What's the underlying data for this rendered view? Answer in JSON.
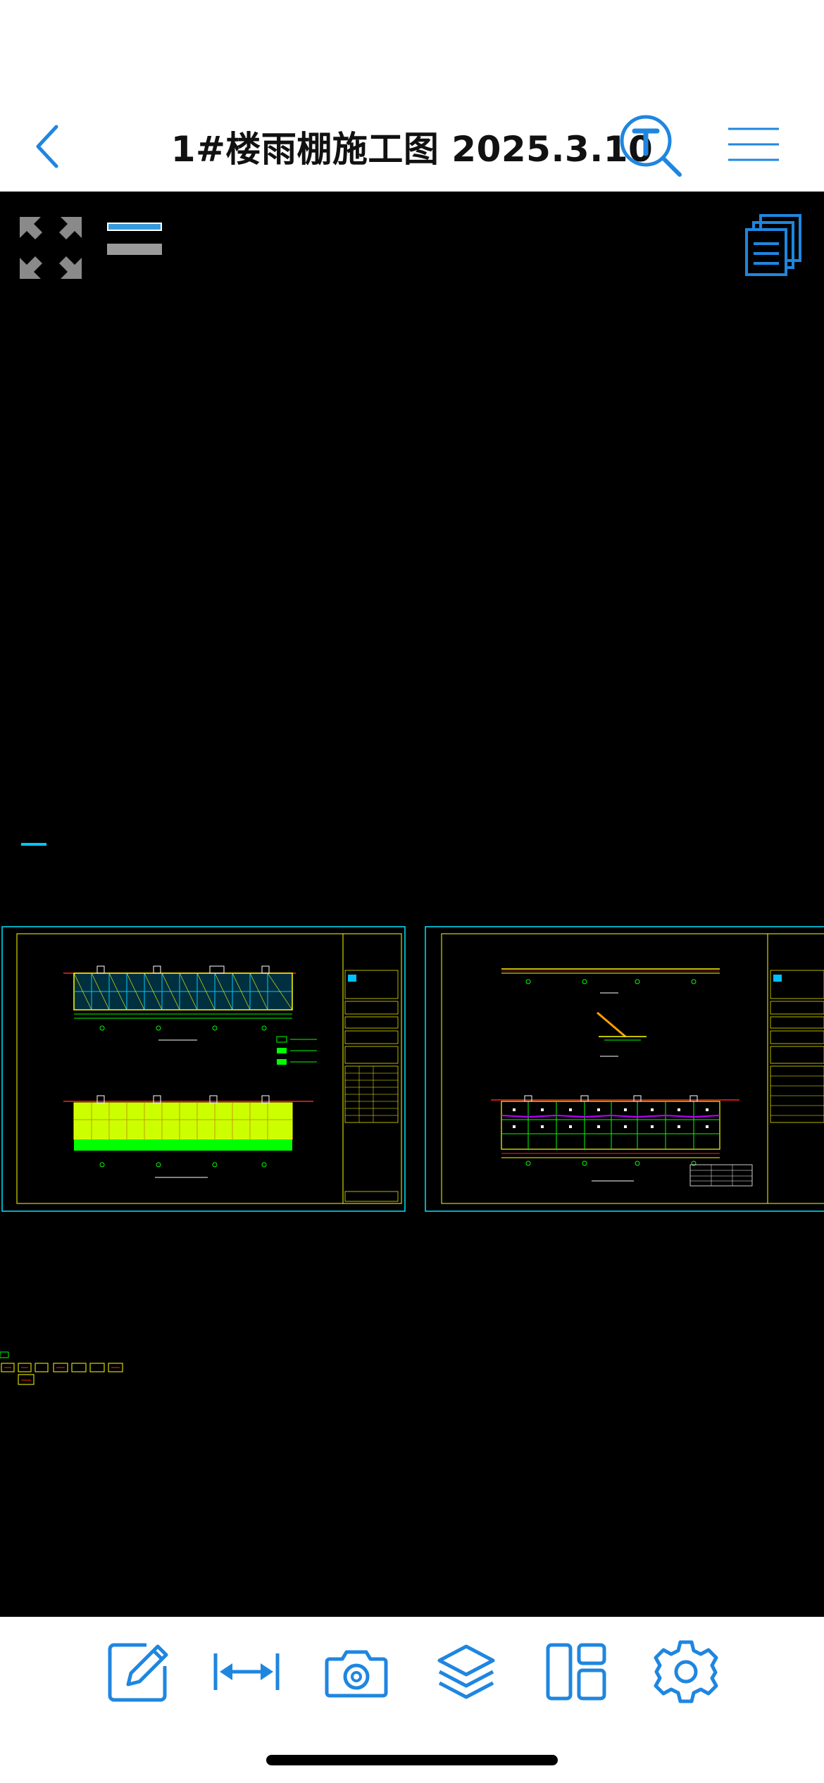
{
  "header": {
    "title": "1#楼雨棚施工图 2025.3.10"
  },
  "icons": {
    "back": "chevron-left-icon",
    "text_search": "text-search-icon",
    "menu": "hamburger-menu-icon",
    "fit_view": "fit-view-icon",
    "layout_toggle": "layout-toggle-icon",
    "layouts": "layouts-stack-icon",
    "annotate": "edit-pencil-icon",
    "measure": "measure-distance-icon",
    "snapshot": "camera-icon",
    "layers": "layers-icon",
    "panels": "panel-layout-icon",
    "settings": "settings-gear-icon"
  },
  "colors": {
    "accent": "#1f86e0",
    "canvas": "#000000",
    "frame": "#00ffff",
    "drawing_yellow": "#ffff00",
    "drawing_green": "#00ff00",
    "drawing_red": "#ff0000",
    "drawing_blue": "#0090ff",
    "drawing_magenta": "#c000ff"
  },
  "canvas": {
    "drawing_sheets": 2
  }
}
